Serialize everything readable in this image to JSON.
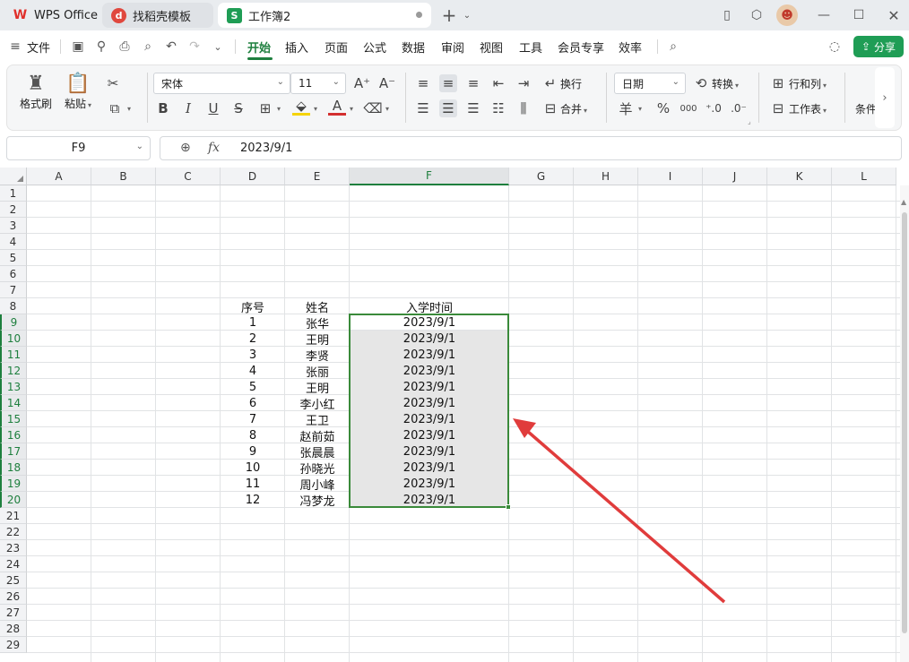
{
  "tabs": [
    {
      "label": "WPS Office",
      "icon": "wps-logo-icon"
    },
    {
      "label": "找稻壳模板",
      "icon": "docer-icon"
    },
    {
      "label": "工作簿2",
      "icon": "spreadsheet-s-icon",
      "icon_text": "S",
      "active": true
    }
  ],
  "menu": {
    "file_label": "文件",
    "items": [
      "开始",
      "插入",
      "页面",
      "公式",
      "数据",
      "审阅",
      "视图",
      "工具",
      "会员专享",
      "效率"
    ],
    "active": "开始",
    "share_label": "分享"
  },
  "ribbon": {
    "format_painter": "格式刷",
    "paste": "粘贴",
    "font_name": "宋体",
    "font_size": "11",
    "bold": "B",
    "italic": "I",
    "underline": "U",
    "strike": "S",
    "wrap_text": "换行",
    "merge": "合并",
    "number_format": "日期",
    "convert": "转换",
    "rows_cols": "行和列",
    "worksheet": "工作表",
    "conditional": "条件",
    "currency_symbol": "羊",
    "percent_symbol": "%",
    "thousands_symbol": "000",
    "accent_color": "#1e7f3e",
    "highlight_color": "#f5d300",
    "font_color": "#d32f2f"
  },
  "formula_bar": {
    "name_box": "F9",
    "fx_label": "fx",
    "value": "2023/9/1"
  },
  "sheet": {
    "columns": [
      "A",
      "B",
      "C",
      "D",
      "E",
      "F",
      "G",
      "H",
      "I",
      "J",
      "K",
      "L"
    ],
    "rows": [
      "1",
      "2",
      "3",
      "4",
      "5",
      "6",
      "7",
      "8",
      "9",
      "10",
      "11",
      "12",
      "13",
      "14",
      "15",
      "16",
      "17",
      "18",
      "19",
      "20",
      "21",
      "22",
      "23",
      "24",
      "25",
      "26",
      "27",
      "28",
      "29"
    ],
    "selected_column": "F",
    "selected_range": "F9:F20",
    "header": {
      "seq": "序号",
      "name": "姓名",
      "date": "入学时间"
    },
    "records": [
      {
        "seq": "1",
        "name": "张华",
        "date": "2023/9/1"
      },
      {
        "seq": "2",
        "name": "王明",
        "date": "2023/9/1"
      },
      {
        "seq": "3",
        "name": "李贤",
        "date": "2023/9/1"
      },
      {
        "seq": "4",
        "name": "张丽",
        "date": "2023/9/1"
      },
      {
        "seq": "5",
        "name": "王明",
        "date": "2023/9/1"
      },
      {
        "seq": "6",
        "name": "李小红",
        "date": "2023/9/1"
      },
      {
        "seq": "7",
        "name": "王卫",
        "date": "2023/9/1"
      },
      {
        "seq": "8",
        "name": "赵前茹",
        "date": "2023/9/1"
      },
      {
        "seq": "9",
        "name": "张晨晨",
        "date": "2023/9/1"
      },
      {
        "seq": "10",
        "name": "孙晓光",
        "date": "2023/9/1"
      },
      {
        "seq": "11",
        "name": "周小峰",
        "date": "2023/9/1"
      },
      {
        "seq": "12",
        "name": "冯梦龙",
        "date": "2023/9/1"
      }
    ],
    "selection_color": "#3a8a3a",
    "annotation_arrow_color": "#e03c3c"
  }
}
